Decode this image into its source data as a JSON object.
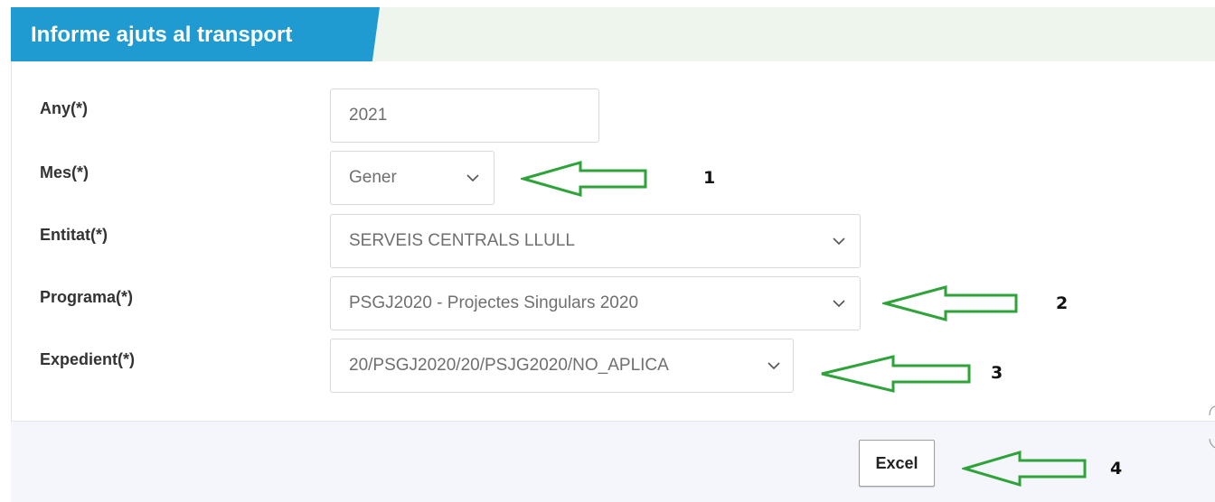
{
  "header": {
    "title": "Informe ajuts al transport"
  },
  "form": {
    "any": {
      "label": "Any(*)",
      "value": "2021"
    },
    "mes": {
      "label": "Mes(*)",
      "value": "Gener"
    },
    "entitat": {
      "label": "Entitat(*)",
      "value": "SERVEIS CENTRALS LLULL"
    },
    "programa": {
      "label": "Programa(*)",
      "value": "PSGJ2020 - Projectes Singulars 2020"
    },
    "expedient": {
      "label": "Expedient(*)",
      "value": "20/PSGJ2020/20/PSJG2020/NO_APLICA"
    }
  },
  "footer": {
    "excel_label": "Excel"
  },
  "annotations": {
    "n1": "1",
    "n2": "2",
    "n3": "3",
    "n4": "4",
    "arrow_color": "#2ea33a"
  },
  "colors": {
    "header_blue": "#1f9bd1",
    "header_bg": "#eef5ec",
    "footer_bg": "#f5f6fb"
  }
}
